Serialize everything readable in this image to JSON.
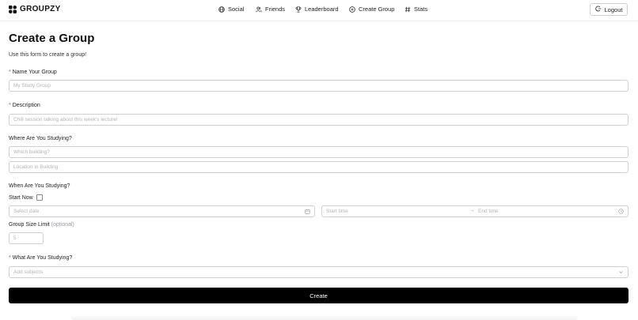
{
  "brand": {
    "name": "GROUPZY"
  },
  "nav": [
    {
      "label": "Social",
      "icon": "globe-icon"
    },
    {
      "label": "Friends",
      "icon": "users-icon"
    },
    {
      "label": "Leaderboard",
      "icon": "trophy-icon"
    },
    {
      "label": "Create Group",
      "icon": "plus-circle-icon"
    },
    {
      "label": "Stats",
      "icon": "hash-icon"
    }
  ],
  "header": {
    "logout_label": "Logout"
  },
  "page": {
    "title": "Create a Group",
    "subtitle": "Use this form to create a group!"
  },
  "form": {
    "required_mark": "*",
    "name": {
      "label": "Name Your Group",
      "placeholder": "My Study Group"
    },
    "description": {
      "label": "Description",
      "placeholder": "Chill session talking about this week's lecture!"
    },
    "where": {
      "label": "Where Are You Studying?",
      "building_placeholder": "Which building?",
      "location_placeholder": "Location in Building"
    },
    "when": {
      "label": "When Are You Studying?",
      "start_now_label": "Start Now",
      "start_now_checked": false,
      "date_placeholder": "Select date",
      "start_time_placeholder": "Start time",
      "range_arrow": "→",
      "end_time_placeholder": "End time"
    },
    "size": {
      "label": "Group Size Limit",
      "optional": "(optional)",
      "value": "5"
    },
    "subjects": {
      "label": "What Are You Studying?",
      "placeholder": "Add subjects"
    },
    "submit_label": "Create"
  },
  "colors": {
    "accent": "#000000",
    "required": "#e5484d",
    "border": "#cfcfcf",
    "placeholder": "#b4b4b4"
  }
}
